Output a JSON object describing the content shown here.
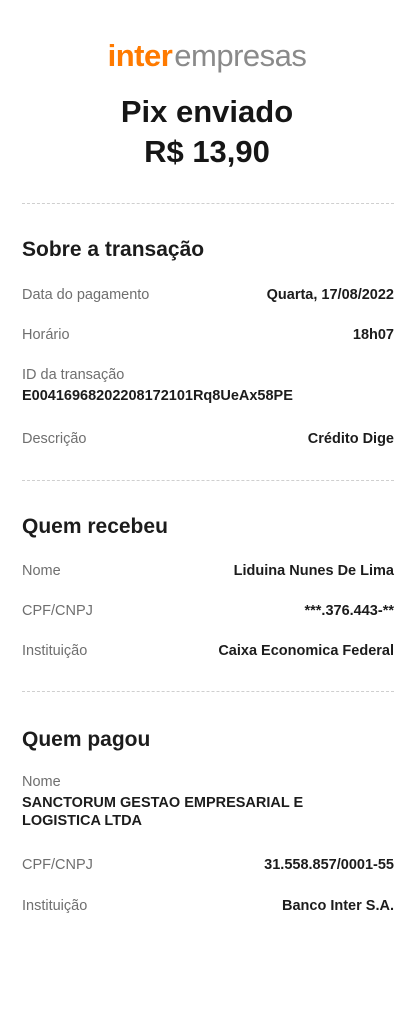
{
  "logo": {
    "brand": "inter",
    "sub": "empresas"
  },
  "header": {
    "title": "Pix enviado",
    "amount": "R$ 13,90"
  },
  "transacao": {
    "title": "Sobre a transação",
    "data_label": "Data do pagamento",
    "data_value": "Quarta, 17/08/2022",
    "horario_label": "Horário",
    "horario_value": "18h07",
    "id_label": "ID da transação",
    "id_value": "E00416968202208172101Rq8UeAx58PE",
    "descricao_label": "Descrição",
    "descricao_value": "Crédito Dige"
  },
  "recebeu": {
    "title": "Quem recebeu",
    "nome_label": "Nome",
    "nome_value": "Liduina Nunes De Lima",
    "cpf_label": "CPF/CNPJ",
    "cpf_value": "***.376.443-**",
    "inst_label": "Instituição",
    "inst_value": "Caixa Economica Federal"
  },
  "pagou": {
    "title": "Quem pagou",
    "nome_label": "Nome",
    "nome_value": "SANCTORUM GESTAO EMPRESARIAL E LOGISTICA LTDA",
    "cpf_label": "CPF/CNPJ",
    "cpf_value": "31.558.857/0001-55",
    "inst_label": "Instituição",
    "inst_value": "Banco Inter S.A."
  },
  "colors": {
    "brand": "#ff7a00",
    "muted": "#6f6f6f",
    "text": "#1c1c1c"
  }
}
